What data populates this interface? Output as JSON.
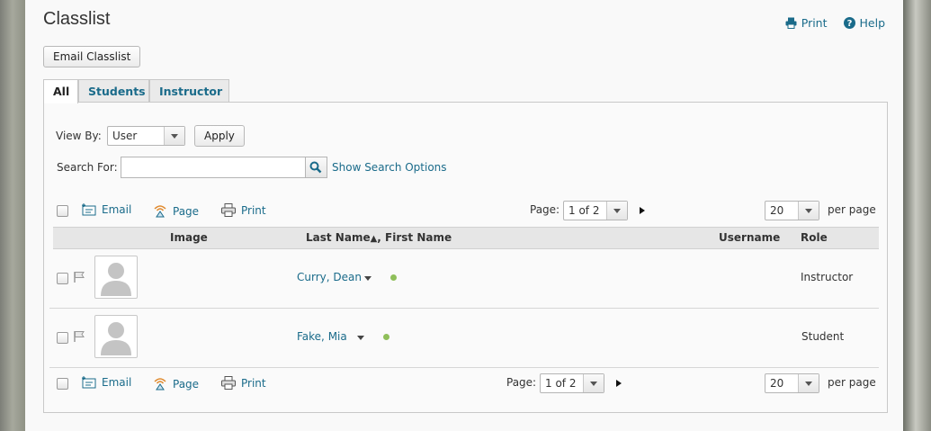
{
  "header": {
    "title": "Classlist",
    "print_label": "Print",
    "help_label": "Help"
  },
  "email_classlist_label": "Email Classlist",
  "tabs": [
    {
      "label": "All",
      "active": true
    },
    {
      "label": "Students",
      "active": false
    },
    {
      "label": "Instructor",
      "active": false
    }
  ],
  "filters": {
    "view_by_label": "View By:",
    "view_by_value": "User",
    "apply_label": "Apply",
    "search_for_label": "Search For:",
    "search_value": "",
    "show_search_options_label": "Show Search Options"
  },
  "toolbar": {
    "email_label": "Email",
    "page_label": "Page",
    "print_label": "Print",
    "page_text": "Page:",
    "page_value": "1 of 2",
    "per_page_value": "20",
    "per_page_label": "per page"
  },
  "table": {
    "columns": {
      "image": "Image",
      "name": "Last Name",
      "name_sort_glyph": "▲",
      "name_suffix": ", First Name",
      "username": "Username",
      "role": "Role"
    },
    "rows": [
      {
        "name": "Curry, Dean",
        "username": "",
        "role": "Instructor"
      },
      {
        "name": "Fake, Mia",
        "username": "",
        "role": "Student"
      }
    ]
  },
  "colors": {
    "link": "#1a6b8a",
    "online": "#8fbf5a"
  }
}
